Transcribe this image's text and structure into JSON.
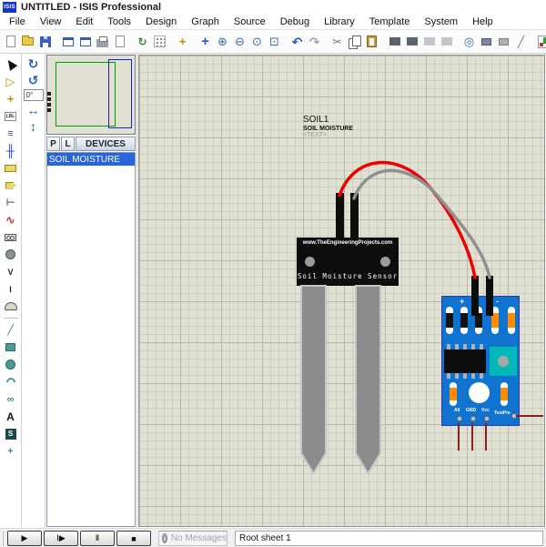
{
  "window": {
    "icon_text": "ISIS",
    "title": "UNTITLED - ISIS Professional"
  },
  "menu": {
    "items": [
      "File",
      "View",
      "Edit",
      "Tools",
      "Design",
      "Graph",
      "Source",
      "Debug",
      "Library",
      "Template",
      "System",
      "Help"
    ]
  },
  "icons": {
    "redraw": "↻",
    "origin": "+",
    "pan": "+",
    "zoom-in": "⊕",
    "zoom-out": "⊖",
    "zoom-all": "⊙",
    "zoom-area": "⊡",
    "undo": "↶",
    "redo": "↷",
    "cut": "✂",
    "pick-parts": "◎",
    "decompose": "╱",
    "component-mode": "▷",
    "junction-dot-mode": "+",
    "wire-label-mode": "LBL",
    "text-script-mode": "≡",
    "buses-mode": "╫",
    "device-pins-mode": "⊢",
    "graph-mode": "∿",
    "voltage-probe-mode": "V",
    "current-probe-mode": "I",
    "2d-line-mode": "╱",
    "2d-path-mode": "∞",
    "2d-text-mode": "A",
    "2d-symbol-mode": "S",
    "2d-marker-mode": "+",
    "rotate-cw": "↻",
    "rotate-ccw": "↺",
    "mirror-h": "↔",
    "mirror-v": "↕",
    "play": "▶",
    "step": "Ⅰ▶",
    "pause": "Ⅱ",
    "stop": "■",
    "info": "i"
  },
  "sidebar": {
    "pick_button": "P",
    "library_button": "L",
    "devices_header": "DEVICES",
    "devices": [
      "SOIL MOISTURE"
    ],
    "rotation_angle": "0°"
  },
  "canvas": {
    "part_ref": "SOIL1",
    "part_value": "SOIL MOISTURE",
    "part_text": "<TEXT>",
    "sensor": {
      "brand": "www.TheEngineeringProjects.com",
      "label": "Soil Moisture Sensor"
    },
    "module": {
      "plus": "+",
      "minus": "-",
      "pins": [
        "A0",
        "GND",
        "Vcc",
        "TestPin"
      ]
    }
  },
  "statusbar": {
    "message": "No Messages",
    "sheet": "Root sheet 1"
  },
  "colors": {
    "accent_blue": "#2765d9",
    "pcb_blue": "#1173d0",
    "wire_red": "#ee0000",
    "wire_gray": "#909090",
    "stub_red": "#8b1f1f",
    "canvas_bg": "#e0e1d3",
    "grid_minor": "#cdcfbd",
    "grid_major": "#b7b9a7",
    "teal": "#00b8b8",
    "orange": "#ff8c00",
    "prong_gray": "#8c8c8c"
  }
}
